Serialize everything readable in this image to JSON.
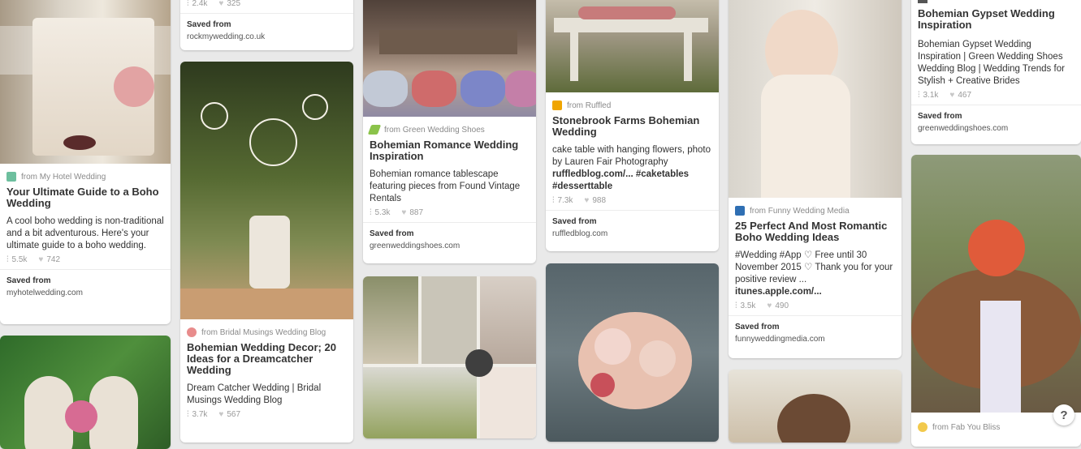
{
  "cards": {
    "c1": {
      "from": "from My Hotel Wedding",
      "title": "Your Ultimate Guide to a Boho Wedding",
      "desc": "A cool boho wedding is non-traditional and a bit adventurous. Here's your ultimate guide to a boho wedding.",
      "repins": "5.5k",
      "likes": "742",
      "saved_label": "Saved from",
      "saved_src": "myhotelwedding.com"
    },
    "c2top": {
      "repins": "2.4k",
      "likes": "325",
      "saved_label": "Saved from",
      "saved_src": "rockmywedding.co.uk"
    },
    "c2": {
      "from": "from Bridal Musings Wedding Blog",
      "title": "Bohemian Wedding Decor; 20 Ideas for a Dreamcatcher Wedding",
      "desc": "Dream Catcher Wedding | Bridal Musings Wedding Blog",
      "repins": "3.7k",
      "likes": "567"
    },
    "c3": {
      "from": "from Green Wedding Shoes",
      "title": "Bohemian Romance Wedding Inspiration",
      "desc": "Bohemian romance tablescape featuring pieces from Found Vintage Rentals",
      "repins": "5.3k",
      "likes": "887",
      "saved_label": "Saved from",
      "saved_src": "greenweddingshoes.com"
    },
    "c4": {
      "from": "from Ruffled",
      "title": "Stonebrook Farms Bohemian Wedding",
      "desc": "cake table with hanging flowers, photo by Lauren Fair Photography",
      "desc_link": "ruffledblog.com/... #caketables #desserttable",
      "repins": "7.3k",
      "likes": "988",
      "saved_label": "Saved from",
      "saved_src": "ruffledblog.com"
    },
    "c5": {
      "from": "from Funny Wedding Media",
      "title": "25 Perfect And Most Romantic Boho Wedding Ideas",
      "desc": "#Wedding #App ♡ Free until 30 November 2015 ♡ Thank you for your positive review ...",
      "desc_link": "itunes.apple.com/...",
      "repins": "3.5k",
      "likes": "490",
      "saved_label": "Saved from",
      "saved_src": "funnyweddingmedia.com"
    },
    "c6": {
      "title": "Bohemian Gypset Wedding Inspiration",
      "desc": "Bohemian Gypset Wedding Inspiration | Green Wedding Shoes Wedding Blog | Wedding Trends for Stylish + Creative Brides",
      "repins": "3.1k",
      "likes": "467",
      "saved_label": "Saved from",
      "saved_src": "greenweddingshoes.com"
    },
    "c6b": {
      "from": "from Fab You Bliss"
    }
  },
  "help": "?",
  "colors": {
    "background": "#e9e9e9",
    "card": "#ffffff"
  }
}
